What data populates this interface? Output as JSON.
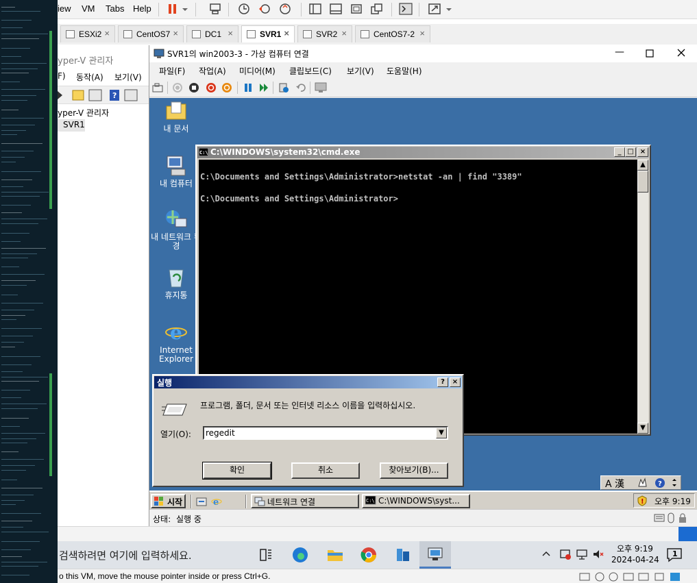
{
  "workstation": {
    "menu": [
      "View",
      "VM",
      "Tabs",
      "Help"
    ],
    "tabs": [
      {
        "label": "ESXi2",
        "active": false
      },
      {
        "label": "CentOS7",
        "active": false
      },
      {
        "label": "DC1",
        "active": false
      },
      {
        "label": "SVR1",
        "active": true
      },
      {
        "label": "SVR2",
        "active": false
      },
      {
        "label": "CentOS7-2",
        "active": false
      }
    ],
    "status_hint": "To direct input to this VM, move the mouse pointer inside or press Ctrl+G.",
    "status_hint_visible": "o this VM, move the mouse pointer inside or press Ctrl+G."
  },
  "hyperv_manager": {
    "title": "yper-V 관리자",
    "menu": [
      "F)",
      "동작(A)",
      "보기(V)"
    ],
    "tree_root": "yper-V 관리자",
    "tree_item": "SVR1"
  },
  "vm_connection": {
    "title": "SVR1의 win2003-3 - 가상 컴퓨터 연결",
    "menu": [
      "파일(F)",
      "작업(A)",
      "미디어(M)",
      "클립보드(C)",
      "보기(V)",
      "도움말(H)"
    ],
    "status_label": "상태:",
    "status_value": "실행 중"
  },
  "guest_desktop": {
    "icons": [
      {
        "label": "내 문서",
        "icon": "my-documents-icon"
      },
      {
        "label": "내 컴퓨터",
        "icon": "my-computer-icon"
      },
      {
        "label": "내 네트워크 환경",
        "icon": "network-places-icon"
      },
      {
        "label": "휴지통",
        "icon": "recycle-bin-icon"
      },
      {
        "label": "Internet Explorer",
        "icon": "internet-explorer-icon"
      }
    ]
  },
  "cmd_window": {
    "title": "C:\\WINDOWS\\system32\\cmd.exe",
    "line1": "C:\\Documents and Settings\\Administrator>netstat -an | find \"3389\"",
    "line2": "C:\\Documents and Settings\\Administrator>"
  },
  "run_dialog": {
    "title": "실행",
    "description": "프로그램, 폴더, 문서 또는 인터넷 리소스 이름을 입력하십시오.",
    "open_label": "열기(O):",
    "open_value": "regedit",
    "ok_label": "확인",
    "cancel_label": "취소",
    "browse_label": "찾아보기(B)..."
  },
  "guest_taskbar": {
    "start_label": "시작",
    "tasks": [
      "네트워크 연결",
      "C:\\WINDOWS\\syst..."
    ],
    "ime": "A 漢",
    "clock": "오후 9:19"
  },
  "host_taskbar": {
    "search_placeholder": "검색하려면 여기에 입력하세요.",
    "time": "오후 9:19",
    "date": "2024-04-24",
    "notification_count": "1"
  }
}
